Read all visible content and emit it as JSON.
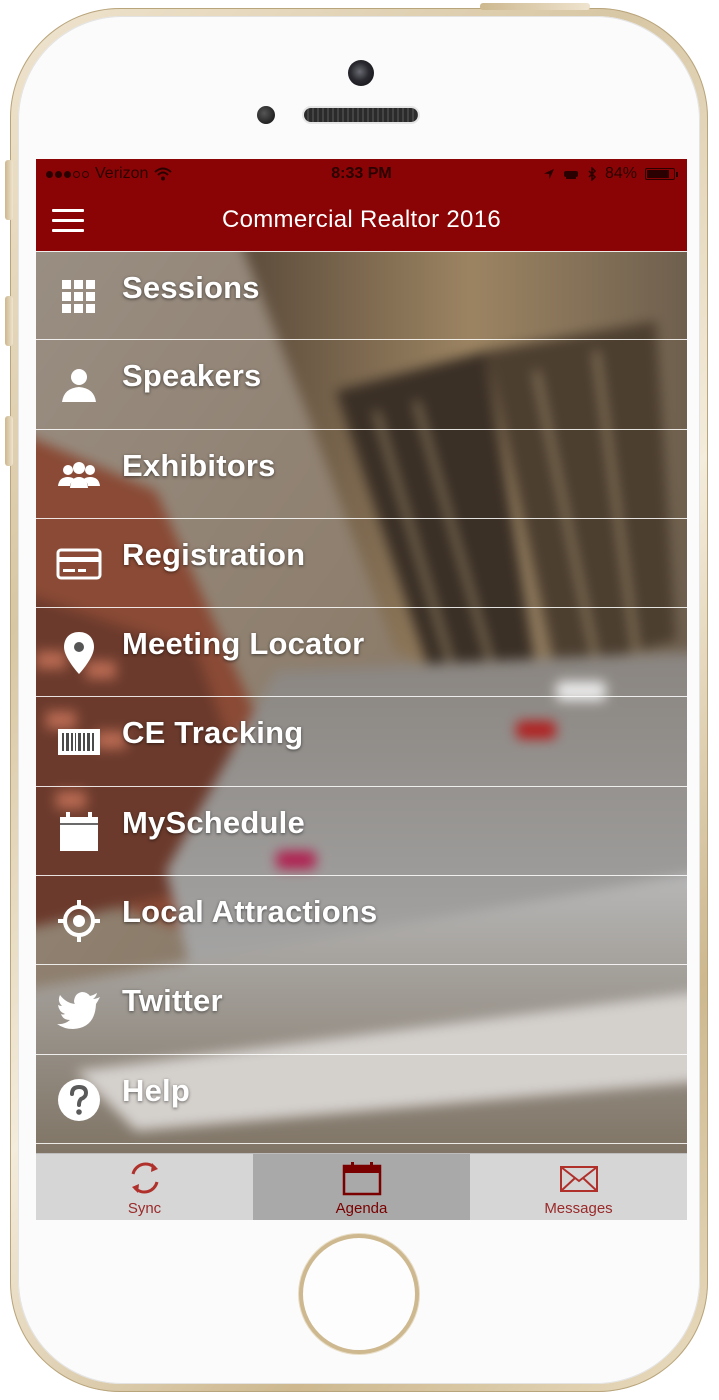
{
  "status_bar": {
    "carrier": "Verizon",
    "time": "8:33 PM",
    "battery": "84%",
    "battery_level": 0.84,
    "signal_bars": 3
  },
  "nav_bar": {
    "title": "Commercial Realtor 2016",
    "menu_icon": "hamburger-icon"
  },
  "menu": {
    "items": [
      {
        "label": "Sessions",
        "icon": "grid-icon"
      },
      {
        "label": "Speakers",
        "icon": "person-icon"
      },
      {
        "label": "Exhibitors",
        "icon": "group-icon"
      },
      {
        "label": "Registration",
        "icon": "credit-card-icon"
      },
      {
        "label": "Meeting Locator",
        "icon": "map-pin-icon"
      },
      {
        "label": "CE Tracking",
        "icon": "barcode-icon"
      },
      {
        "label": "MySchedule",
        "icon": "calendar-icon"
      },
      {
        "label": "Local Attractions",
        "icon": "target-icon"
      },
      {
        "label": "Twitter",
        "icon": "twitter-bird-icon"
      },
      {
        "label": "Help",
        "icon": "question-icon"
      }
    ]
  },
  "tab_bar": {
    "tabs": [
      {
        "label": "Sync",
        "icon": "sync-icon",
        "active": false
      },
      {
        "label": "Agenda",
        "icon": "calendar-icon",
        "active": true
      },
      {
        "label": "Messages",
        "icon": "envelope-icon",
        "active": false
      }
    ]
  },
  "colors": {
    "brand": "#8a0405",
    "tab_bar_bg": "#d6d6d6",
    "tab_active_bg": "#a9a9a9",
    "tab_label": "#9a2a2a"
  }
}
